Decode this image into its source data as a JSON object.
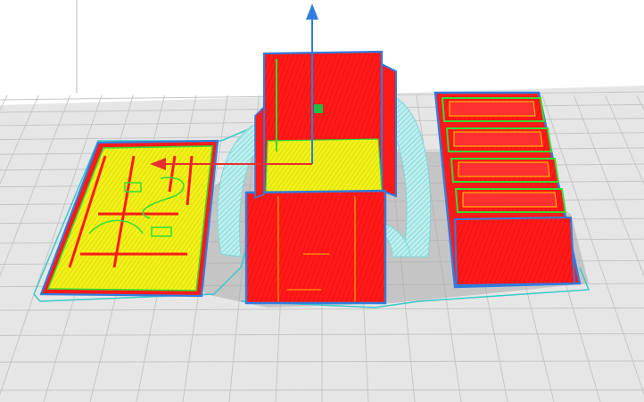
{
  "app": {
    "view": "slicer-layer-preview",
    "colors": {
      "background": "#ffffff",
      "bed": "#e6e6e6",
      "grid_line": "#c6c6c6",
      "bed_shadow": "#cfcfcf",
      "shell_outer": "#2f7de0",
      "wall_red": "#ff1a1a",
      "infill_yellow": "#f2f21a",
      "inner_wall_green": "#33dd33",
      "support_cyan": "#7fd6d6",
      "skirt_cyan": "#36c9c9",
      "gizmo_axis_blue": "#2f7de0",
      "gizmo_axis_red": "#e63030",
      "gizmo_center_green": "#22bb44"
    }
  },
  "scene": {
    "objects": [
      {
        "name": "flat-plate",
        "type": "top-infill"
      },
      {
        "name": "tall-box",
        "type": "walls-with-infill-floor"
      },
      {
        "name": "drawer-boxes",
        "count": 4,
        "type": "walls"
      }
    ],
    "supports": [
      "left-arch-support",
      "right-arch-support"
    ],
    "gizmo": {
      "axes": [
        "z-axis",
        "x-axis"
      ]
    },
    "icons": {
      "z_arrow": "arrow-up-icon",
      "x_arrow": "arrow-left-icon",
      "center": "square-handle-icon"
    }
  }
}
